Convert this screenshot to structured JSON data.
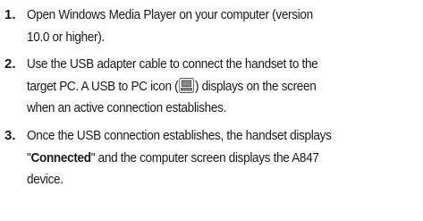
{
  "steps": [
    {
      "number": "1.",
      "lines": [
        "Open Windows Media Player on your computer (version",
        "10.0 or higher)."
      ]
    },
    {
      "number": "2.",
      "line1": "Use the USB adapter cable to connect the handset to the",
      "line2_before": "target PC. A USB to PC icon (",
      "line2_after": ") displays on the screen",
      "line3": "when an active connection establishes.",
      "icon": "usb-to-pc-icon"
    },
    {
      "number": "3.",
      "line1": "Once the USB connection establishes, the handset displays",
      "line2_quote_open": "\"",
      "line2_bold": "Connected",
      "line2_rest": "\" and the computer screen displays the A847",
      "line3": "device."
    }
  ]
}
